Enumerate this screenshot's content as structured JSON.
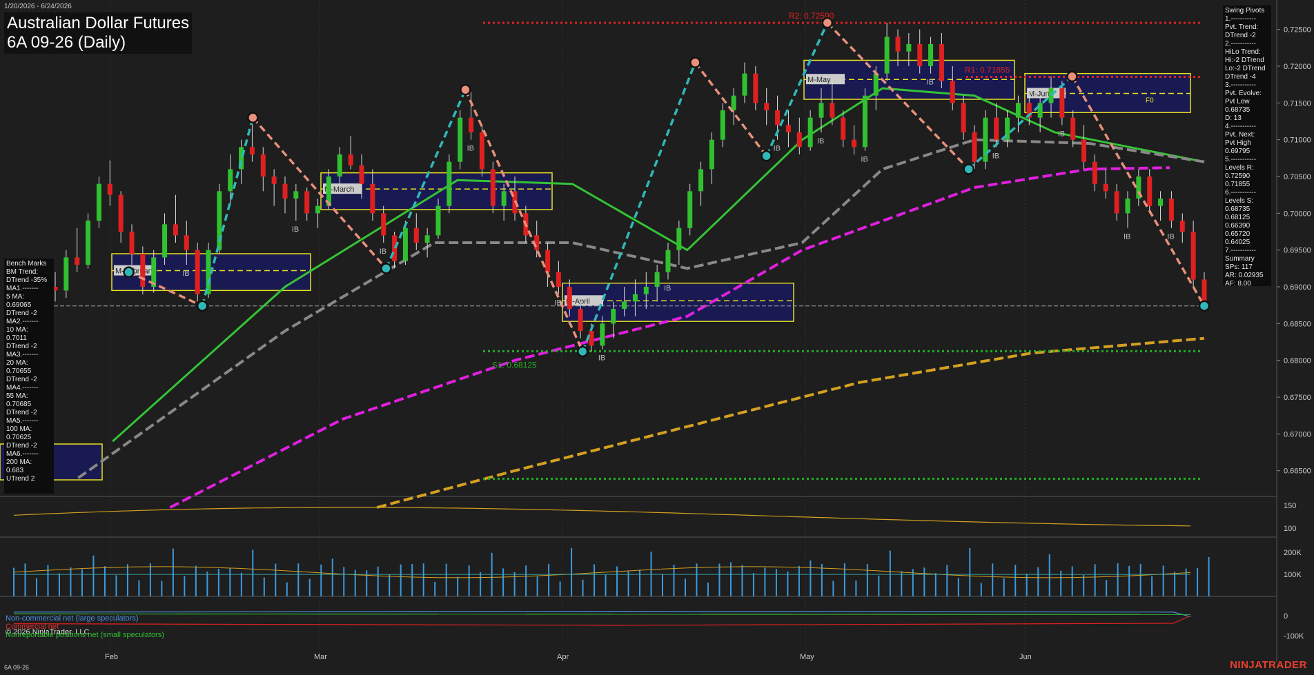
{
  "header": {
    "date_range": "1/20/2026 - 6/24/2026",
    "title": "Australian Dollar Futures",
    "subtitle": "6A 09-26 (Daily)",
    "instrument": "6A 09-26",
    "brand": "NINJATRADER",
    "copyright": "© 2026 NinjaTrader, LLC"
  },
  "bench_marks": {
    "title": "Bench Marks",
    "lines": [
      "BM Trend:",
      "DTrend -35%",
      "MA1.-------",
      "5 MA:",
      "0.69065",
      "DTrend -2",
      "MA2.-------",
      "10 MA:",
      "0.7011",
      "DTrend -2",
      "MA3.-------",
      "20 MA:",
      "0.70655",
      "DTrend -2",
      "MA4.-------",
      "55 MA:",
      "0.70685",
      "DTrend -2",
      "MA5.-------",
      "100 MA:",
      "0.70625",
      "DTrend -2",
      "MA6.-------",
      "200 MA:",
      "0.683",
      "UTrend 2"
    ]
  },
  "swing_pivots": {
    "title": "Swing Pivots",
    "lines": [
      "1.-----------",
      "Pvt. Trend:",
      "DTrend -2",
      "2.-----------",
      "HiLo Trend:",
      "Hi:-2 DTrend",
      "Lo:-2 DTrend",
      "DTrend -4",
      "3.-----------",
      "Pvt. Evolve:",
      "Pvt Low",
      "0.68735",
      "D: 13",
      "4.-----------",
      "Pvt. Next:",
      "Pvt High",
      "0.69795",
      "5.-----------",
      "Levels R:",
      "0.72590",
      "0.71855",
      "6.-----------",
      "Levels S:",
      "0.68735",
      "0.68125",
      "0.66390",
      "0.65720",
      "0.64025",
      "7.-----------",
      "Summary",
      "SPs: 117",
      "AR: 0.02935",
      "AF: 8.00"
    ]
  },
  "chart_data": {
    "type": "candlestick",
    "x_axis_labels": [
      "Feb",
      "Mar",
      "Apr",
      "May",
      "Jun"
    ],
    "price_axis": {
      "range": [
        0.6615,
        0.7275
      ],
      "ticks": [
        "0.72500",
        "0.72000",
        "0.71500",
        "0.71000",
        "0.70500",
        "0.70000",
        "0.69500",
        "0.69000",
        "0.68500",
        "0.68000",
        "0.67500",
        "0.67000",
        "0.66500"
      ]
    },
    "levels": [
      {
        "label": "R2: 0.72590",
        "price": 0.7259,
        "color": "#e02020"
      },
      {
        "label": "R1: 0.71855",
        "price": 0.71855,
        "color": "#e02020"
      },
      {
        "label": "S1: 0.68125",
        "price": 0.68125,
        "color": "#20b020"
      },
      {
        "label": "",
        "price": 0.6639,
        "color": "#20b020"
      },
      {
        "label": "",
        "price": 0.6874,
        "color": "#aaaaaa"
      }
    ],
    "monthly_boxes": [
      {
        "label": "M-February",
        "hi": 0.6945,
        "lo": 0.6895,
        "mid": 0.6922
      },
      {
        "label": "M-March",
        "hi": 0.7055,
        "lo": 0.7005,
        "mid": 0.7033
      },
      {
        "label": "M-April",
        "hi": 0.6905,
        "lo": 0.6853,
        "mid": 0.6881
      },
      {
        "label": "M-May",
        "hi": 0.7208,
        "lo": 0.7155,
        "mid": 0.7182
      },
      {
        "label": "M-June",
        "hi": 0.719,
        "lo": 0.7137,
        "mid": 0.7163
      }
    ],
    "box_note": "F0",
    "candles_ohlc": [
      [
        0.69,
        0.692,
        0.688,
        0.6895
      ],
      [
        0.6895,
        0.695,
        0.6885,
        0.694
      ],
      [
        0.694,
        0.698,
        0.692,
        0.693
      ],
      [
        0.693,
        0.7,
        0.6925,
        0.699
      ],
      [
        0.699,
        0.705,
        0.698,
        0.704
      ],
      [
        0.704,
        0.7072,
        0.701,
        0.7025
      ],
      [
        0.7025,
        0.703,
        0.696,
        0.6975
      ],
      [
        0.6975,
        0.6985,
        0.693,
        0.6945
      ],
      [
        0.6945,
        0.6955,
        0.689,
        0.69
      ],
      [
        0.69,
        0.695,
        0.6892,
        0.694
      ],
      [
        0.694,
        0.7,
        0.693,
        0.6985
      ],
      [
        0.6985,
        0.7025,
        0.696,
        0.697
      ],
      [
        0.697,
        0.699,
        0.693,
        0.695
      ],
      [
        0.695,
        0.696,
        0.688,
        0.689
      ],
      [
        0.689,
        0.696,
        0.6885,
        0.695
      ],
      [
        0.695,
        0.704,
        0.6945,
        0.703
      ],
      [
        0.703,
        0.708,
        0.701,
        0.706
      ],
      [
        0.706,
        0.71,
        0.704,
        0.709
      ],
      [
        0.709,
        0.7122,
        0.707,
        0.708
      ],
      [
        0.708,
        0.709,
        0.703,
        0.705
      ],
      [
        0.705,
        0.706,
        0.701,
        0.704
      ],
      [
        0.704,
        0.705,
        0.7,
        0.702
      ],
      [
        0.702,
        0.704,
        0.699,
        0.703
      ],
      [
        0.703,
        0.7035,
        0.699,
        0.7
      ],
      [
        0.7,
        0.702,
        0.698,
        0.701
      ],
      [
        0.701,
        0.706,
        0.7005,
        0.705
      ],
      [
        0.705,
        0.709,
        0.704,
        0.708
      ],
      [
        0.708,
        0.7105,
        0.706,
        0.7065
      ],
      [
        0.7065,
        0.708,
        0.702,
        0.704
      ],
      [
        0.704,
        0.706,
        0.699,
        0.7
      ],
      [
        0.7,
        0.701,
        0.696,
        0.697
      ],
      [
        0.697,
        0.6975,
        0.6925,
        0.6935
      ],
      [
        0.6935,
        0.699,
        0.693,
        0.698
      ],
      [
        0.698,
        0.7,
        0.695,
        0.696
      ],
      [
        0.696,
        0.698,
        0.694,
        0.697
      ],
      [
        0.697,
        0.702,
        0.6965,
        0.701
      ],
      [
        0.701,
        0.708,
        0.7,
        0.707
      ],
      [
        0.707,
        0.714,
        0.706,
        0.713
      ],
      [
        0.713,
        0.7165,
        0.71,
        0.711
      ],
      [
        0.711,
        0.712,
        0.705,
        0.706
      ],
      [
        0.706,
        0.707,
        0.7,
        0.701
      ],
      [
        0.701,
        0.704,
        0.699,
        0.703
      ],
      [
        0.703,
        0.705,
        0.699,
        0.7
      ],
      [
        0.7,
        0.701,
        0.696,
        0.697
      ],
      [
        0.697,
        0.699,
        0.694,
        0.695
      ],
      [
        0.695,
        0.696,
        0.69,
        0.692
      ],
      [
        0.692,
        0.6935,
        0.689,
        0.69
      ],
      [
        0.69,
        0.691,
        0.686,
        0.687
      ],
      [
        0.687,
        0.688,
        0.683,
        0.684
      ],
      [
        0.684,
        0.685,
        0.6812,
        0.682
      ],
      [
        0.682,
        0.686,
        0.6815,
        0.685
      ],
      [
        0.685,
        0.688,
        0.683,
        0.687
      ],
      [
        0.687,
        0.69,
        0.686,
        0.688
      ],
      [
        0.688,
        0.691,
        0.686,
        0.689
      ],
      [
        0.689,
        0.692,
        0.687,
        0.69
      ],
      [
        0.69,
        0.693,
        0.688,
        0.692
      ],
      [
        0.692,
        0.696,
        0.691,
        0.695
      ],
      [
        0.695,
        0.699,
        0.693,
        0.698
      ],
      [
        0.698,
        0.704,
        0.697,
        0.703
      ],
      [
        0.703,
        0.707,
        0.701,
        0.706
      ],
      [
        0.706,
        0.711,
        0.704,
        0.71
      ],
      [
        0.71,
        0.715,
        0.709,
        0.714
      ],
      [
        0.714,
        0.717,
        0.712,
        0.716
      ],
      [
        0.716,
        0.7205,
        0.715,
        0.719
      ],
      [
        0.719,
        0.72,
        0.714,
        0.715
      ],
      [
        0.715,
        0.717,
        0.712,
        0.714
      ],
      [
        0.714,
        0.716,
        0.71,
        0.712
      ],
      [
        0.712,
        0.714,
        0.709,
        0.711
      ],
      [
        0.711,
        0.713,
        0.708,
        0.709
      ],
      [
        0.709,
        0.714,
        0.7085,
        0.713
      ],
      [
        0.713,
        0.717,
        0.711,
        0.715
      ],
      [
        0.715,
        0.718,
        0.712,
        0.713
      ],
      [
        0.713,
        0.714,
        0.709,
        0.71
      ],
      [
        0.71,
        0.712,
        0.708,
        0.709
      ],
      [
        0.709,
        0.717,
        0.7085,
        0.716
      ],
      [
        0.716,
        0.72,
        0.714,
        0.719
      ],
      [
        0.719,
        0.7259,
        0.718,
        0.724
      ],
      [
        0.724,
        0.725,
        0.72,
        0.722
      ],
      [
        0.722,
        0.7245,
        0.72,
        0.723
      ],
      [
        0.723,
        0.725,
        0.719,
        0.72
      ],
      [
        0.72,
        0.724,
        0.719,
        0.723
      ],
      [
        0.723,
        0.7245,
        0.717,
        0.718
      ],
      [
        0.718,
        0.72,
        0.714,
        0.715
      ],
      [
        0.715,
        0.716,
        0.71,
        0.711
      ],
      [
        0.711,
        0.712,
        0.706,
        0.707
      ],
      [
        0.707,
        0.714,
        0.706,
        0.713
      ],
      [
        0.713,
        0.715,
        0.709,
        0.71
      ],
      [
        0.71,
        0.714,
        0.709,
        0.713
      ],
      [
        0.713,
        0.716,
        0.711,
        0.715
      ],
      [
        0.715,
        0.717,
        0.712,
        0.713
      ],
      [
        0.713,
        0.716,
        0.711,
        0.715
      ],
      [
        0.715,
        0.7186,
        0.713,
        0.717
      ],
      [
        0.717,
        0.718,
        0.712,
        0.713
      ],
      [
        0.713,
        0.714,
        0.709,
        0.71
      ],
      [
        0.71,
        0.712,
        0.706,
        0.707
      ],
      [
        0.707,
        0.708,
        0.703,
        0.704
      ],
      [
        0.704,
        0.706,
        0.702,
        0.703
      ],
      [
        0.703,
        0.704,
        0.699,
        0.7
      ],
      [
        0.7,
        0.703,
        0.698,
        0.702
      ],
      [
        0.702,
        0.706,
        0.701,
        0.705
      ],
      [
        0.705,
        0.706,
        0.7,
        0.701
      ],
      [
        0.701,
        0.703,
        0.699,
        0.702
      ],
      [
        0.702,
        0.703,
        0.698,
        0.699
      ],
      [
        0.699,
        0.7,
        0.696,
        0.6975
      ],
      [
        0.6975,
        0.699,
        0.69,
        0.691
      ],
      [
        0.691,
        0.692,
        0.6874,
        0.688
      ]
    ],
    "moving_averages": [
      {
        "name": "20 MA",
        "color": "#35c435",
        "points": [
          [
            0.05,
            0.669
          ],
          [
            0.2,
            0.69
          ],
          [
            0.35,
            0.7045
          ],
          [
            0.45,
            0.704
          ],
          [
            0.55,
            0.695
          ],
          [
            0.65,
            0.71
          ],
          [
            0.72,
            0.717
          ],
          [
            0.8,
            0.716
          ],
          [
            0.87,
            0.711
          ],
          [
            1.0,
            0.707
          ]
        ]
      },
      {
        "name": "55 MA",
        "color": "#888888",
        "points": [
          [
            0.02,
            0.664
          ],
          [
            0.2,
            0.684
          ],
          [
            0.33,
            0.696
          ],
          [
            0.45,
            0.696
          ],
          [
            0.55,
            0.6925
          ],
          [
            0.65,
            0.696
          ],
          [
            0.72,
            0.706
          ],
          [
            0.8,
            0.71
          ],
          [
            0.9,
            0.7095
          ],
          [
            1.0,
            0.707
          ]
        ]
      },
      {
        "name": "100 MA",
        "color": "#e020e0",
        "points": [
          [
            0.1,
            0.66
          ],
          [
            0.25,
            0.672
          ],
          [
            0.4,
            0.68
          ],
          [
            0.55,
            0.686
          ],
          [
            0.65,
            0.695
          ],
          [
            0.8,
            0.7035
          ],
          [
            0.9,
            0.706
          ],
          [
            0.97,
            0.7062
          ]
        ]
      },
      {
        "name": "200 MA",
        "color": "#d4a020",
        "points": [
          [
            0.28,
            0.66
          ],
          [
            0.4,
            0.665
          ],
          [
            0.55,
            0.671
          ],
          [
            0.7,
            0.677
          ],
          [
            0.85,
            0.681
          ],
          [
            1.0,
            0.683
          ]
        ]
      }
    ],
    "swing_lines": [
      [
        0.064,
        0.692
      ],
      [
        0.128,
        0.6874
      ],
      [
        0.172,
        0.713
      ],
      [
        0.288,
        0.6925
      ],
      [
        0.357,
        0.7168
      ],
      [
        0.459,
        0.6812
      ],
      [
        0.557,
        0.7205
      ],
      [
        0.619,
        0.7078
      ],
      [
        0.672,
        0.7259
      ],
      [
        0.795,
        0.706
      ],
      [
        0.885,
        0.7186
      ],
      [
        1.0,
        0.6874
      ]
    ],
    "volume_axis": {
      "ticks": [
        "200K",
        "100K"
      ]
    },
    "osc_axis": {
      "ticks": [
        "150",
        "100"
      ]
    },
    "cot_axis": {
      "ticks": [
        "0",
        "-100K"
      ]
    },
    "cot_legend": [
      "Non-commercial net (large speculators)",
      "Commercial net",
      "Nonreportable positions net (small speculators)"
    ],
    "marker_label": "IB"
  }
}
